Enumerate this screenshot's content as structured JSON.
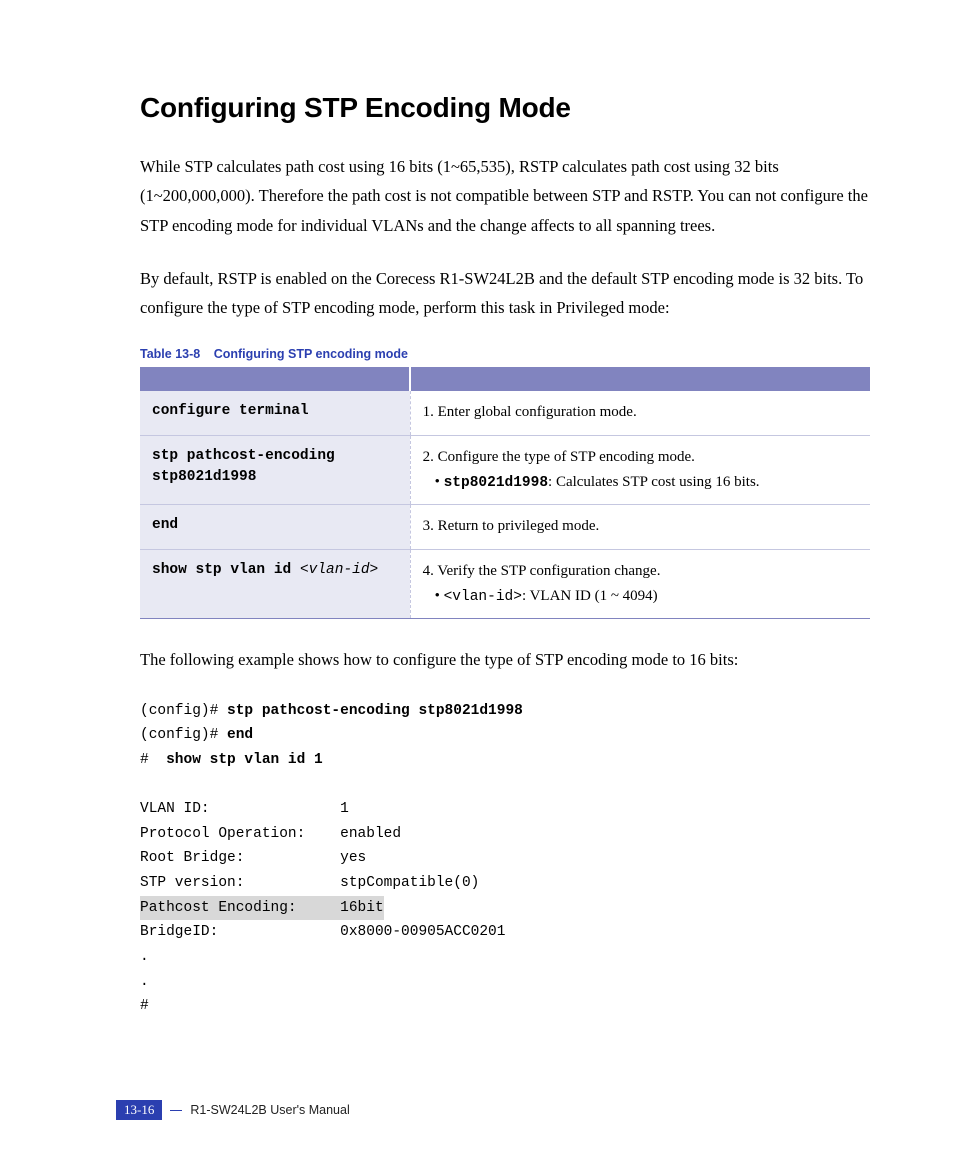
{
  "heading": "Configuring STP Encoding Mode",
  "para1": "While STP calculates path cost using 16 bits (1~65,535), RSTP calculates path cost using 32 bits (1~200,000,000). Therefore the path cost is not compatible between STP and RSTP. You can not configure the STP encoding mode for individual VLANs and the change affects to all spanning trees.",
  "para2": "By default, RSTP is enabled on the Corecess R1-SW24L2B and the default STP encoding mode is 32 bits. To configure the type of STP encoding mode, perform this task in Privileged mode:",
  "tableCaption": {
    "num": "Table 13-8",
    "text": "Configuring STP encoding mode"
  },
  "rows": [
    {
      "cmd": "configure terminal",
      "step": "1. Enter global configuration mode."
    },
    {
      "cmd": "stp pathcost-encoding stp8021d1998",
      "step": "2. Configure the type of STP encoding mode.",
      "bulletMono": "stp8021d1998",
      "bulletRest": ": Calculates STP cost using 16 bits."
    },
    {
      "cmd": "end",
      "step": "3. Return to privileged mode."
    },
    {
      "cmd": "show stp vlan id ",
      "cmdParam": "<vlan-id>",
      "step": "4. Verify the STP configuration change.",
      "bulletMono": "<vlan-id>",
      "bulletRest": ": VLAN ID (1 ~ 4094)"
    }
  ],
  "para3": "The following example shows how to configure the type of STP encoding mode to 16 bits:",
  "example": {
    "l1prompt": "(config)# ",
    "l1cmd": "stp pathcost-encoding stp8021d1998",
    "l2prompt": "(config)# ",
    "l2cmd": "end",
    "l3prompt": "#  ",
    "l3cmd": "show stp vlan id 1",
    "out1": "VLAN ID:               1",
    "out2": "Protocol Operation:    enabled",
    "out3": "Root Bridge:           yes",
    "out4": "STP version:           stpCompatible(0)",
    "out5": "Pathcost Encoding:     16bit",
    "out6": "BridgeID:              0x8000-00905ACC0201",
    "dot": ".",
    "hash": "#"
  },
  "footer": {
    "page": "13-16",
    "doc": "R1-SW24L2B   User's Manual"
  }
}
